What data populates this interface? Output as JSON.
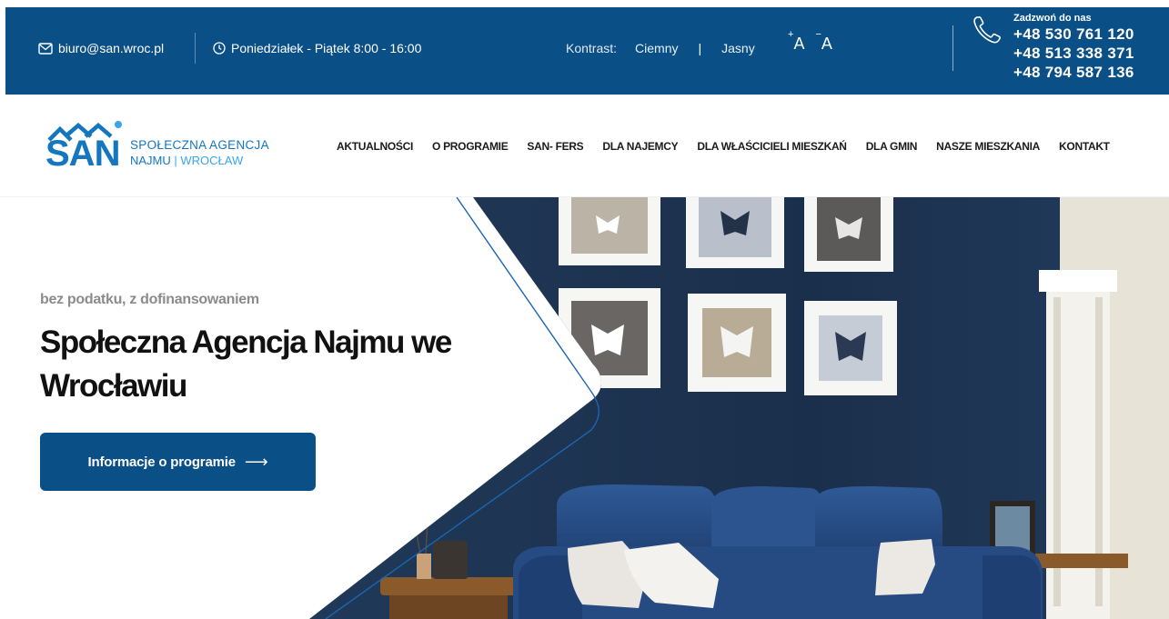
{
  "topbar": {
    "email": "biuro@san.wroc.pl",
    "hours": "Poniedziałek - Piątek 8:00 - 16:00",
    "contrast_label": "Kontrast:",
    "contrast_dark": "Ciemny",
    "contrast_divider": "|",
    "contrast_light": "Jasny",
    "font_increase": "A",
    "font_increase_sign": "+",
    "font_decrease": "A",
    "font_decrease_sign": "−",
    "phone_label": "Zadzwoń do nas",
    "phones": [
      "+48 530 761 120",
      "+48 513 338 371",
      "+48 794 587 136"
    ]
  },
  "logo": {
    "mark": "SAN",
    "line1": "SPOŁECZNA AGENCJA",
    "line2_a": "NAJMU",
    "line2_sep": " | ",
    "line2_b": "WROCŁAW"
  },
  "nav": {
    "items": [
      "AKTUALNOŚCI",
      "O PROGRAMIE",
      "SAN- FERS",
      "DLA NAJEMCY",
      "DLA WŁAŚCICIELI MIESZKAŃ",
      "DLA GMIN",
      "NASZE MIESZKANIA",
      "KONTAKT"
    ]
  },
  "hero": {
    "eyebrow": "bez podatku, z dofinansowaniem",
    "headline": "Społeczna Agencja Najmu we Wrocławiu",
    "cta_label": "Informacje o programie",
    "cta_arrow": "⟶"
  },
  "colors": {
    "brand_dark_blue": "#0b4f87",
    "logo_blue": "#1576c0",
    "logo_light_blue": "#3aa6e6",
    "wall_navy": "#1e3350"
  },
  "icons": {
    "email": "envelope-icon",
    "hours": "clock-icon",
    "phone": "phone-icon"
  }
}
